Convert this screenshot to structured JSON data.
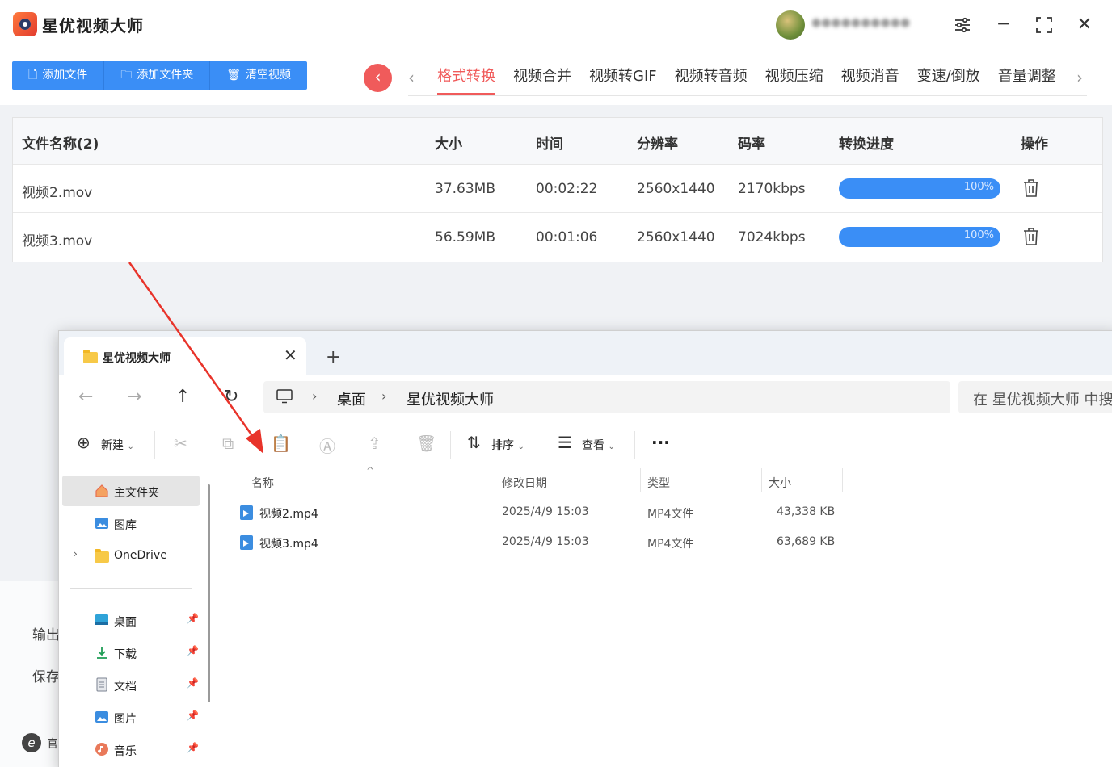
{
  "app": {
    "title": "星优视频大师",
    "username": "●●●●●●●●●●",
    "window_min": "─",
    "window_max": "⛶",
    "window_close": "✕",
    "toolbar": {
      "add_file": "添加文件",
      "add_folder": "添加文件夹",
      "clear": "清空视频"
    },
    "tabs": [
      "格式转换",
      "视频合并",
      "视频转GIF",
      "视频转音频",
      "视频压缩",
      "视频消音",
      "变速/倒放",
      "音量调整"
    ],
    "active_tab": "格式转换",
    "table": {
      "headers": {
        "name": "文件名称(2)",
        "size": "大小",
        "time": "时间",
        "resolution": "分辨率",
        "bitrate": "码率",
        "progress": "转换进度",
        "action": "操作"
      },
      "rows": [
        {
          "name": "视频2.mov",
          "size": "37.63MB",
          "time": "00:02:22",
          "resolution": "2560x1440",
          "bitrate": "2170kbps",
          "progress": "100%",
          "progress_value": 1.0
        },
        {
          "name": "视频3.mov",
          "size": "56.59MB",
          "time": "00:01:06",
          "resolution": "2560x1440",
          "bitrate": "7024kbps",
          "progress": "100%",
          "progress_value": 1.0
        }
      ]
    },
    "bottom_labels": {
      "output": "输出",
      "save": "保存",
      "official": "官"
    }
  },
  "explorer": {
    "tab_title": "星优视频大师",
    "new_tab": "+",
    "breadcrumb": [
      "桌面",
      "星优视频大师"
    ],
    "search_placeholder": "在 星优视频大师 中搜索",
    "commands": {
      "new": "新建",
      "sort": "排序",
      "view": "查看",
      "more": "···"
    },
    "sidebar": {
      "home": "主文件夹",
      "gallery": "图库",
      "onedrive": "OneDrive",
      "desktop": "桌面",
      "downloads": "下载",
      "documents": "文档",
      "pictures": "图片",
      "music": "音乐"
    },
    "columns": {
      "name": "名称",
      "modified": "修改日期",
      "type": "类型",
      "size": "大小"
    },
    "files": [
      {
        "name": "视频2.mp4",
        "modified": "2025/4/9 15:03",
        "type": "MP4文件",
        "size": "43,338 KB"
      },
      {
        "name": "视频3.mp4",
        "modified": "2025/4/9 15:03",
        "type": "MP4文件",
        "size": "63,689 KB"
      }
    ]
  },
  "colors": {
    "accent_blue": "#3a8ef6",
    "accent_red": "#f05b5b",
    "arrow_red": "#e8332a"
  }
}
